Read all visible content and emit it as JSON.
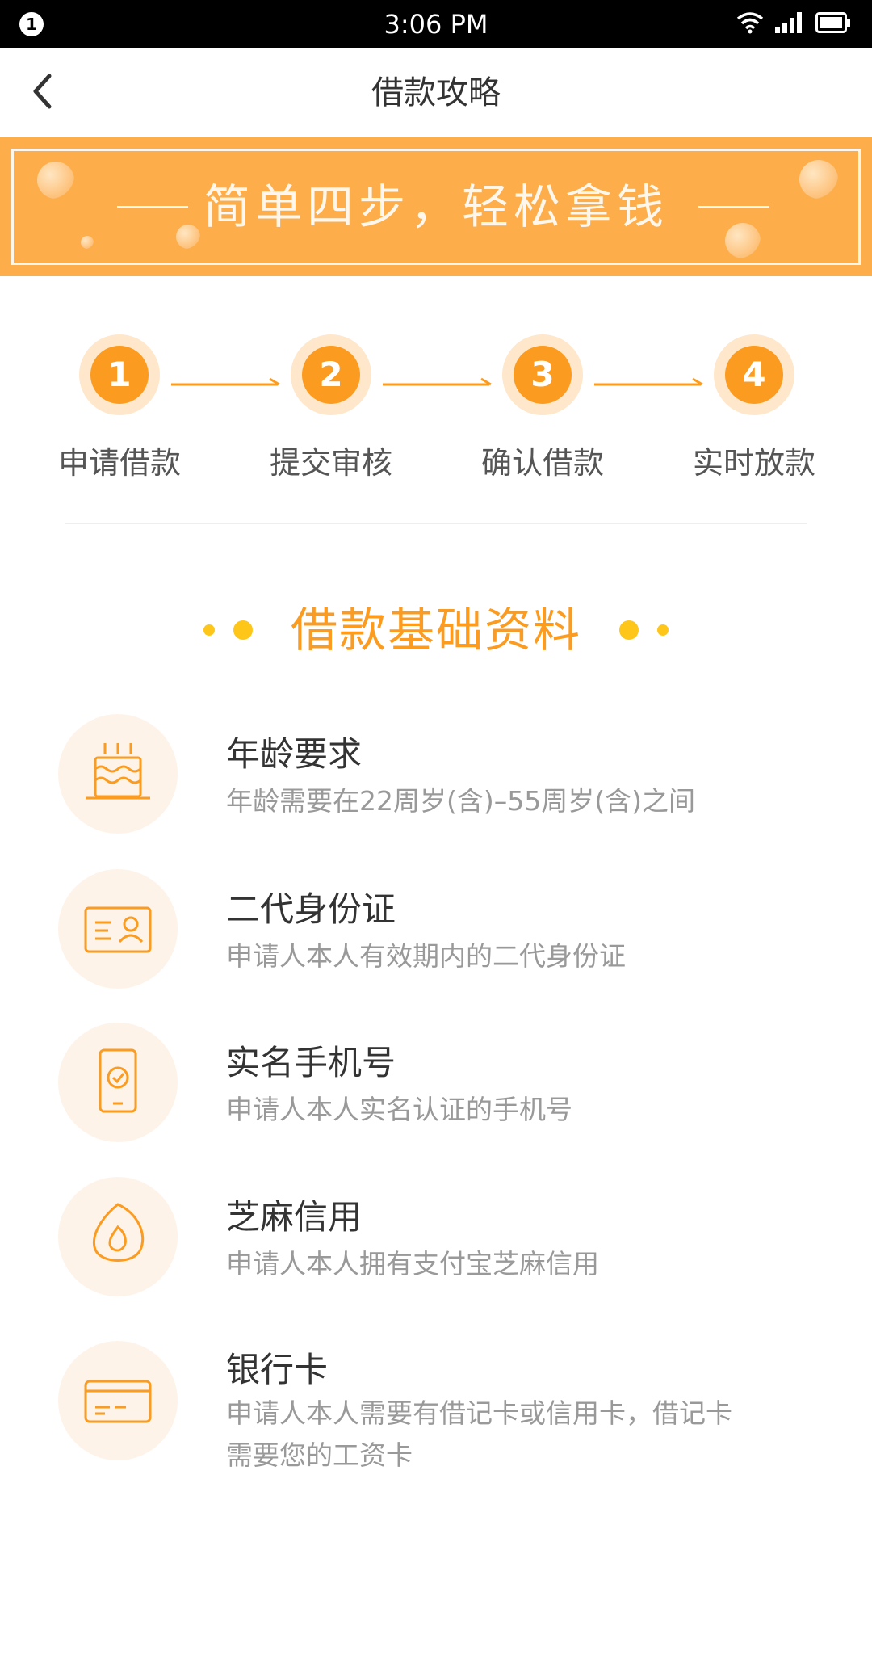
{
  "status_bar": {
    "notification_count": "1",
    "time": "3:06 PM",
    "icons": [
      "wifi-icon",
      "signal-icon",
      "battery-icon"
    ]
  },
  "nav": {
    "title": "借款攻略",
    "back_icon": "chevron-left-icon"
  },
  "banner": {
    "text": "简单四步，轻松拿钱"
  },
  "steps": [
    {
      "number": "1",
      "label": "申请借款"
    },
    {
      "number": "2",
      "label": "提交审核"
    },
    {
      "number": "3",
      "label": "确认借款"
    },
    {
      "number": "4",
      "label": "实时放款"
    }
  ],
  "section": {
    "title": "借款基础资料"
  },
  "requirements": [
    {
      "icon": "cake-icon",
      "title": "年龄要求",
      "desc": "年龄需要在22周岁(含)–55周岁(含)之间"
    },
    {
      "icon": "id-card-icon",
      "title": "二代身份证",
      "desc": "申请人本人有效期内的二代身份证"
    },
    {
      "icon": "phone-verified-icon",
      "title": "实名手机号",
      "desc": "申请人本人实名认证的手机号"
    },
    {
      "icon": "sesame-credit-icon",
      "title": "芝麻信用",
      "desc": "申请人本人拥有支付宝芝麻信用"
    },
    {
      "icon": "bank-card-icon",
      "title": "银行卡",
      "desc": "申请人本人需要有借记卡或信用卡，借记卡需要您的工资卡"
    }
  ],
  "colors": {
    "accent": "#fb9b1f",
    "banner": "#fdae4a",
    "dot": "#ffc61a",
    "icon_bg": "#fef3e9"
  }
}
